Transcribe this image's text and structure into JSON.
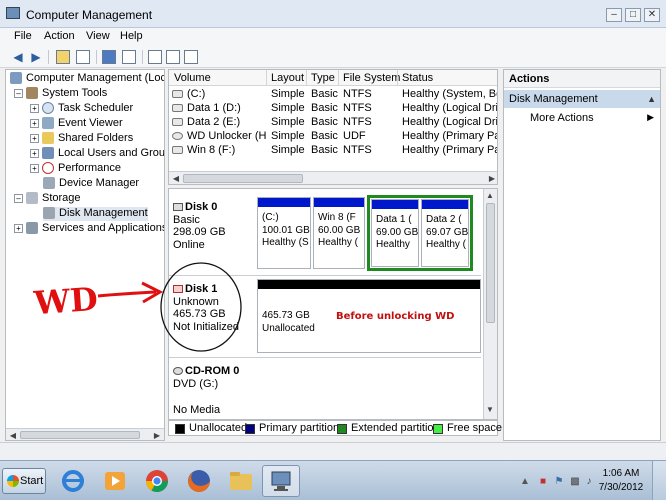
{
  "window": {
    "title": "Computer Management"
  },
  "menu": [
    "File",
    "Action",
    "View",
    "Help"
  ],
  "tree": {
    "root": "Computer Management (Local",
    "system_tools": "System Tools",
    "task_scheduler": "Task Scheduler",
    "event_viewer": "Event Viewer",
    "shared_folders": "Shared Folders",
    "local_users": "Local Users and Groups",
    "performance": "Performance",
    "device_manager": "Device Manager",
    "storage": "Storage",
    "disk_management": "Disk Management",
    "services": "Services and Applications"
  },
  "volume_table": {
    "headers": [
      "Volume",
      "Layout",
      "Type",
      "File System",
      "Status"
    ],
    "rows": [
      {
        "volume": "(C:)",
        "layout": "Simple",
        "type": "Basic",
        "fs": "NTFS",
        "status": "Healthy (System, Boot"
      },
      {
        "volume": "Data 1 (D:)",
        "layout": "Simple",
        "type": "Basic",
        "fs": "NTFS",
        "status": "Healthy (Logical Drive"
      },
      {
        "volume": "Data 2 (E:)",
        "layout": "Simple",
        "type": "Basic",
        "fs": "NTFS",
        "status": "Healthy (Logical Drive"
      },
      {
        "volume": "WD Unlocker (H:)",
        "layout": "Simple",
        "type": "Basic",
        "fs": "UDF",
        "status": "Healthy (Primary Part"
      },
      {
        "volume": "Win 8 (F:)",
        "layout": "Simple",
        "type": "Basic",
        "fs": "NTFS",
        "status": "Healthy (Primary Part"
      }
    ]
  },
  "disks": {
    "disk0": {
      "name": "Disk 0",
      "kind": "Basic",
      "size": "298.09 GB",
      "state": "Online",
      "partitions": [
        {
          "name": "(C:)",
          "size": "100.01 GB",
          "status": "Healthy (S"
        },
        {
          "name": "Win 8  (F",
          "size": "60.00 GB",
          "status": "Healthy ("
        },
        {
          "name": "Data 1  (",
          "size": "69.00 GB",
          "status": "Healthy"
        },
        {
          "name": "Data 2  (",
          "size": "69.07 GB",
          "status": "Healthy ("
        }
      ]
    },
    "disk1": {
      "name": "Disk 1",
      "kind": "Unknown",
      "size": "465.73 GB",
      "state": "Not Initialized",
      "partition": {
        "size": "465.73 GB",
        "status": "Unallocated",
        "note": "Before unlocking WD"
      }
    },
    "cdrom": {
      "name": "CD-ROM 0",
      "kind": "DVD (G:)",
      "state": "No Media"
    }
  },
  "legend": [
    {
      "label": "Unallocated",
      "color": "#000000"
    },
    {
      "label": "Primary partition",
      "color": "#000080"
    },
    {
      "label": "Extended partition",
      "color": "#1f8a1f"
    },
    {
      "label": "Free space",
      "color": "#44ee44"
    }
  ],
  "actions": {
    "header": "Actions",
    "section": "Disk Management",
    "more": "More Actions"
  },
  "annotation": {
    "text": "WD"
  },
  "taskbar": {
    "start_label": "Start",
    "time": "1:06 AM",
    "date": "7/30/2012"
  },
  "colors": {
    "primary_bar": "#0018cc",
    "unallocated_bar": "#000000",
    "extended_border": "#1f8a1f",
    "note_text": "#c01010"
  }
}
